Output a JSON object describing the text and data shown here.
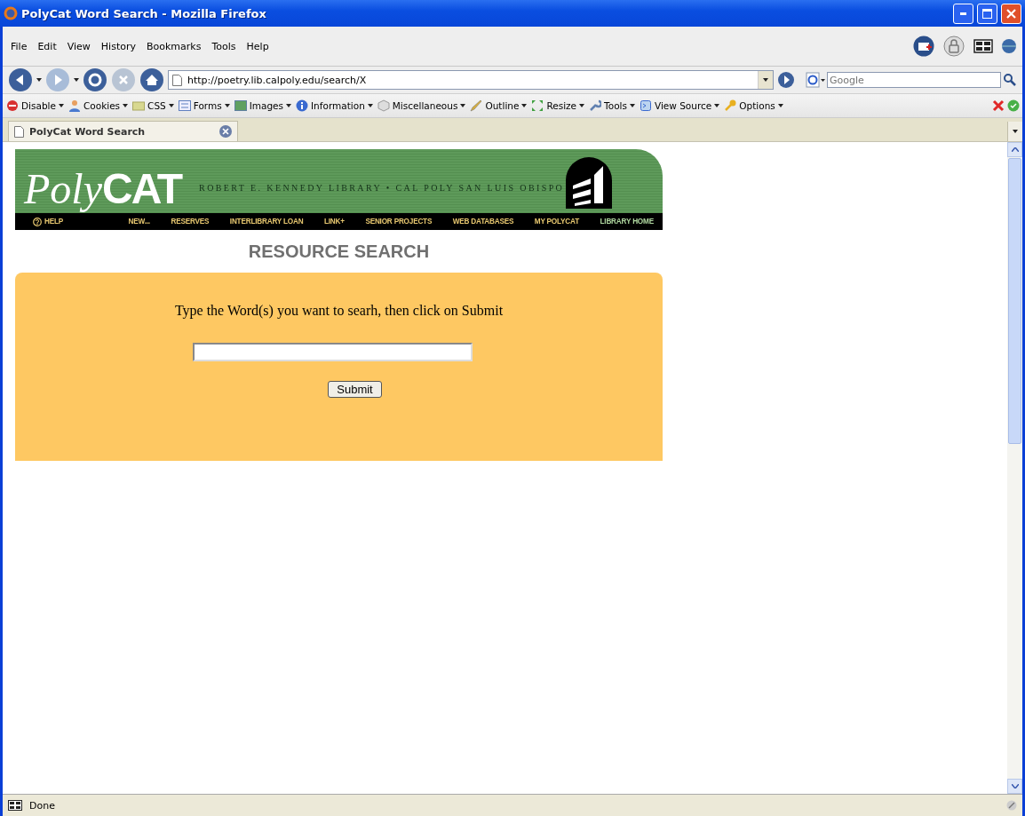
{
  "window": {
    "title": "PolyCat Word Search - Mozilla Firefox"
  },
  "menu": [
    "File",
    "Edit",
    "View",
    "History",
    "Bookmarks",
    "Tools",
    "Help"
  ],
  "navigation": {
    "address": "http://poetry.lib.calpoly.edu/search/X",
    "search_placeholder": "Google"
  },
  "developer_toolbar": [
    "Disable",
    "Cookies",
    "CSS",
    "Forms",
    "Images",
    "Information",
    "Miscellaneous",
    "Outline",
    "Resize",
    "Tools",
    "View Source",
    "Options"
  ],
  "tabs": [
    {
      "label": "PolyCat Word Search",
      "selected": true
    }
  ],
  "page": {
    "banner": {
      "logo_script": "Poly",
      "logo_caps": "CAT",
      "tagline": "ROBERT E. KENNEDY LIBRARY • CAL POLY SAN LUIS OBISPO",
      "links": [
        {
          "label": "HELP",
          "current": false
        },
        {
          "label": "NEW...",
          "current": false
        },
        {
          "label": "RESERVES",
          "current": false
        },
        {
          "label": "INTERLIBRARY LOAN",
          "current": false
        },
        {
          "label": "LINK+",
          "current": false
        },
        {
          "label": "SENIOR PROJECTS",
          "current": false
        },
        {
          "label": "WEB DATABASES",
          "current": false
        },
        {
          "label": "MY POLYCAT",
          "current": false
        },
        {
          "label": "LIBRARY HOME",
          "current": true
        }
      ]
    },
    "heading": "RESOURCE SEARCH",
    "form": {
      "instruction": "Type the Word(s) you want to searh, then click on Submit",
      "button": "Submit"
    }
  },
  "status_bar": {
    "text": "Done"
  }
}
